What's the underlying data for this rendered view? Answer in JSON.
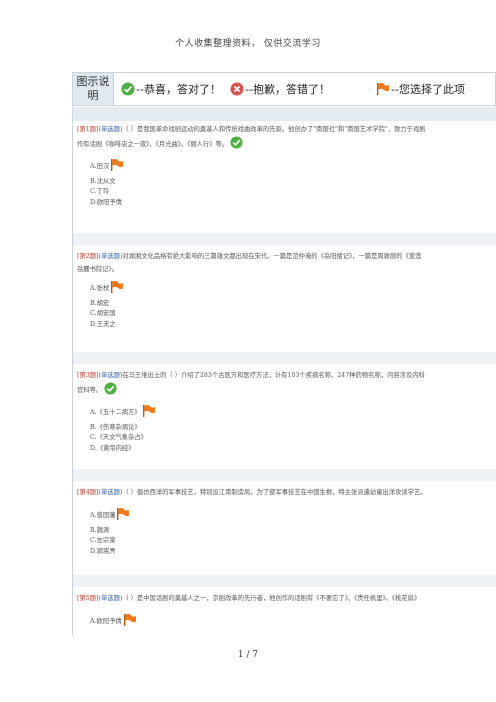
{
  "header_note": "个人收集整理资料，  仅供交流学习",
  "legend": {
    "label": "图示说明",
    "correct_text": "--恭喜，答对了！",
    "wrong_text": "--抱歉，答错了！",
    "selected_text": "--您选择了此项"
  },
  "questions": [
    {
      "num": "[第1题]",
      "type": "(单选题)",
      "line1": "（ ）是我国革命戏剧运动的奠基人和传统戏曲改革的先驱。他创办了\"南国社\"和\"南国艺术学院\"，致力于戏剧",
      "line2": "作有话剧《咖啡店之一夜》、《月光曲》、《丽人行》等。",
      "options": [
        "A.田汉",
        "B.沈从文",
        "C.丁玲",
        "D.欧阳予倩"
      ]
    },
    {
      "num": "[第2题]",
      "type": "(单选题)",
      "line1": "对湖湘文化品格有绝大影响的三篇雄文都出现在宋代。一篇是范仲淹的《岳阳楼记》，一篇是周敦颐的《爱莲",
      "line2": "岳麓书院记》。",
      "options": [
        "A.张栻",
        "B.胡宏",
        "C.胡安国",
        "D.王夫之"
      ]
    },
    {
      "num": "[第3题]",
      "type": "(单选题)",
      "line1": "在马王堆出土的（ ）介绍了283个古医方和医疗方法，计有103个疾病名称、247种药物名称，内容涉及内科",
      "line2": "官科等。",
      "options": [
        "A.《五十二病方》",
        "B.《伤寒杂病论》",
        "C.《天文气象杂占》",
        "D.《黄帝内经》"
      ]
    },
    {
      "num": "[第4题]",
      "type": "(单选题)",
      "line1": "（ ）倡仿西洋的军事技艺，特别设江南制造局，为了使军事技艺在中国生根，特主张派遣幼童出洋攻读学艺。",
      "line2": "",
      "options": [
        "A.曾国藩",
        "B.魏源",
        "C.左宗棠",
        "D.郭嵩焘"
      ]
    },
    {
      "num": "[第5题]",
      "type": "(单选题)",
      "line1": "（ ）是中国话剧的奠基人之一，京剧改革的先行者，他创作的话剧有《不要忘了》、《责任帆里》、《桃花扇》",
      "line2": "",
      "options": [
        "A.欧阳予倩"
      ]
    }
  ],
  "footer": "1 / 7",
  "colors": {
    "correct": "#4caf3f",
    "wrong": "#d9534f",
    "flag": "#f07a1a"
  }
}
